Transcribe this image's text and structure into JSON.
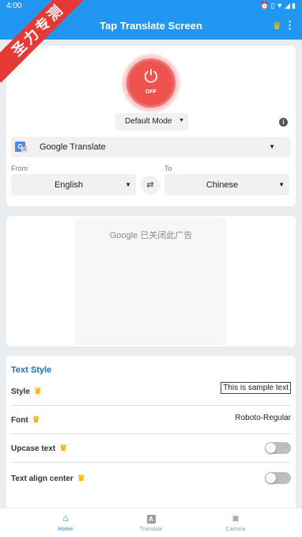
{
  "status_bar": {
    "time": "4:00",
    "icons": [
      "alarm-icon",
      "vibrate-icon",
      "wifi-icon",
      "signal-icon",
      "battery-icon"
    ]
  },
  "app_bar": {
    "title": "Tap Translate Screen",
    "icons": [
      "crown-icon",
      "more-vert-icon"
    ]
  },
  "watermark": {
    "text": "圣力专测",
    "color": "#e53935"
  },
  "power": {
    "state_label": "OFF",
    "color": "#ef5350"
  },
  "mode_select": {
    "value": "Default Mode"
  },
  "translator_select": {
    "value": "Google Translate",
    "icon": "google-translate-icon"
  },
  "languages": {
    "from_caption": "From",
    "to_caption": "To",
    "from_value": "English",
    "to_value": "Chinese"
  },
  "ad": {
    "text": "Google 已关闭此广告"
  },
  "text_style": {
    "title": "Text Style",
    "style_label": "Style",
    "style_sample": "This is sample text",
    "font_label": "Font",
    "font_value": "Roboto-Regular",
    "upcase_label": "Upcase text",
    "upcase_on": false,
    "align_label": "Text align center",
    "align_on": false
  },
  "bottom_nav": {
    "items": [
      {
        "label": "Home",
        "icon": "home-icon",
        "active": true
      },
      {
        "label": "Translate",
        "icon": "translate-icon",
        "active": false
      },
      {
        "label": "Camera",
        "icon": "camera-icon",
        "active": false
      }
    ]
  },
  "colors": {
    "primary": "#2196f3",
    "accent_title": "#1e6fb8",
    "crown": "#ffb300"
  }
}
